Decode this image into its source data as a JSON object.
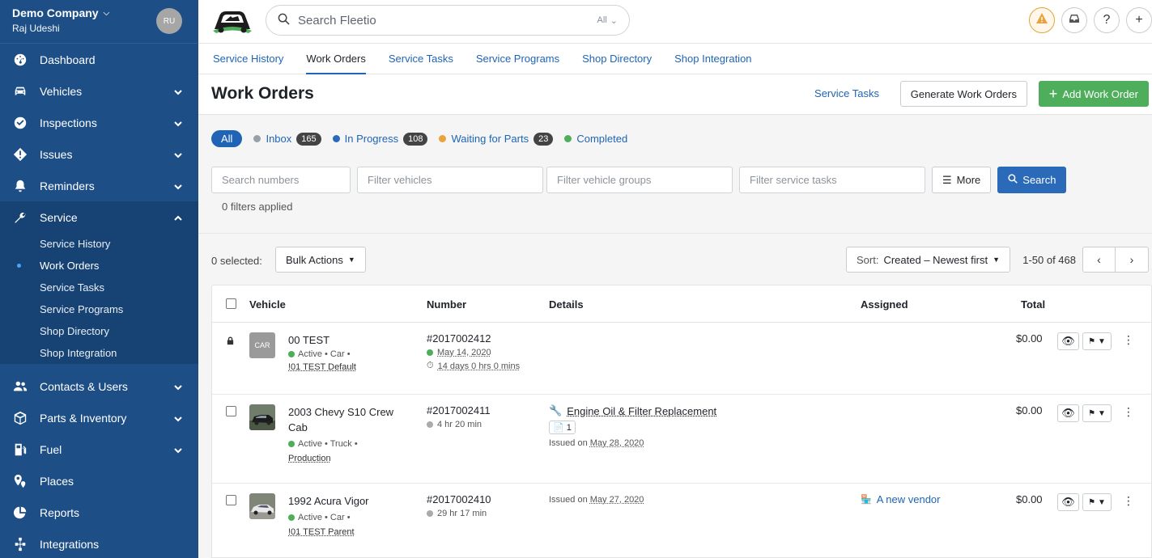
{
  "sidebar": {
    "company": "Demo Company",
    "user": "Raj Udeshi",
    "avatar_initials": "RU",
    "items": [
      {
        "label": "Dashboard",
        "icon": "dashboard-icon"
      },
      {
        "label": "Vehicles",
        "icon": "car-icon"
      },
      {
        "label": "Inspections",
        "icon": "check-circle-icon"
      },
      {
        "label": "Issues",
        "icon": "issue-diamond-icon"
      },
      {
        "label": "Reminders",
        "icon": "bell-icon"
      },
      {
        "label": "Service",
        "icon": "wrench-icon"
      },
      {
        "label": "Contacts & Users",
        "icon": "users-icon"
      },
      {
        "label": "Parts & Inventory",
        "icon": "box-icon"
      },
      {
        "label": "Fuel",
        "icon": "fuel-icon"
      },
      {
        "label": "Places",
        "icon": "places-icon"
      },
      {
        "label": "Reports",
        "icon": "pie-chart-icon"
      },
      {
        "label": "Integrations",
        "icon": "integrations-icon"
      }
    ],
    "service_sub": [
      "Service History",
      "Work Orders",
      "Service Tasks",
      "Service Programs",
      "Shop Directory",
      "Shop Integration"
    ]
  },
  "topbar": {
    "search_placeholder": "Search Fleetio",
    "search_scope": "All"
  },
  "subtabs": [
    "Service History",
    "Work Orders",
    "Service Tasks",
    "Service Programs",
    "Shop Directory",
    "Shop Integration"
  ],
  "header": {
    "title": "Work Orders",
    "service_tasks_link": "Service Tasks",
    "generate_label": "Generate Work Orders",
    "add_label": "Add Work Order"
  },
  "status_pills": {
    "all": "All",
    "inbox": {
      "label": "Inbox",
      "count": "165",
      "color": "#9aa0a6"
    },
    "in_progress": {
      "label": "In Progress",
      "count": "108",
      "color": "#2a6ab8"
    },
    "waiting": {
      "label": "Waiting for Parts",
      "count": "23",
      "color": "#e8a33d"
    },
    "completed": {
      "label": "Completed",
      "color": "#4fae5b"
    }
  },
  "filters": {
    "numbers_placeholder": "Search numbers",
    "vehicles_placeholder": "Filter vehicles",
    "groups_placeholder": "Filter vehicle groups",
    "tasks_placeholder": "Filter service tasks",
    "more_label": "More",
    "search_label": "Search",
    "applied_text": "0 filters applied"
  },
  "list": {
    "selected_text": "0 selected:",
    "bulk_label": "Bulk Actions",
    "sort_prefix": "Sort:",
    "sort_value": "Created – Newest first",
    "range": "1-50 of 468"
  },
  "table": {
    "columns": {
      "vehicle": "Vehicle",
      "number": "Number",
      "details": "Details",
      "assigned": "Assigned",
      "total": "Total"
    },
    "rows": [
      {
        "vehicle": "00 TEST",
        "thumb": "CAR",
        "meta": "Active • Car •",
        "group": "!01 TEST Default",
        "number": "#2017002412",
        "sub1": "May 14, 2020",
        "sub2": "14 days 0 hrs 0 mins",
        "total": "$0.00"
      },
      {
        "vehicle": "2003 Chevy S10 Crew Cab",
        "meta": "Active • Truck •",
        "group": "Production",
        "number": "#2017002411",
        "sub1": "4 hr 20 min",
        "detail_title": "Engine Oil & Filter Replacement",
        "doc_count": "1",
        "issued_prefix": "Issued on",
        "issued_date": "May 28, 2020",
        "total": "$0.00"
      },
      {
        "vehicle": "1992 Acura Vigor",
        "meta": "Active • Car •",
        "group": "!01 TEST Parent",
        "number": "#2017002410",
        "sub1": "29 hr 17 min",
        "issued_prefix": "Issued on",
        "issued_date": "May 27, 2020",
        "vendor": "A new vendor",
        "total": "$0.00"
      }
    ]
  }
}
